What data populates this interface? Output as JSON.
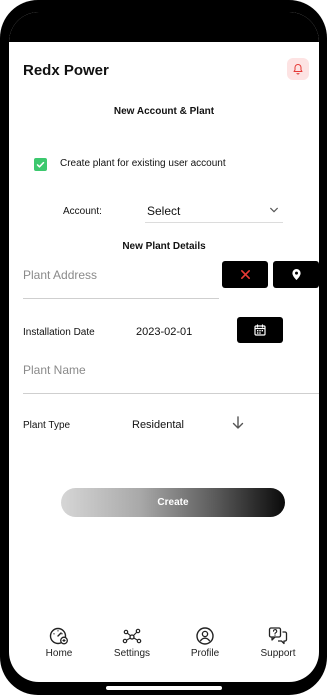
{
  "app": {
    "title": "Redx Power"
  },
  "page": {
    "title": "New Account & Plant"
  },
  "existing_account": {
    "label": "Create plant for existing user account",
    "checked": true
  },
  "account": {
    "label": "Account:",
    "value": "Select"
  },
  "plant_details": {
    "title": "New Plant Details",
    "address_placeholder": "Plant Address",
    "installation_date_label": "Installation Date",
    "installation_date_value": "2023-02-01",
    "name_placeholder": "Plant Name",
    "type_label": "Plant Type",
    "type_value": "Residental"
  },
  "create_button": {
    "label": "Create"
  },
  "tabs": [
    {
      "label": "Home",
      "icon": "home-gauge-icon"
    },
    {
      "label": "Settings",
      "icon": "settings-nodes-icon"
    },
    {
      "label": "Profile",
      "icon": "profile-icon"
    },
    {
      "label": "Support",
      "icon": "support-chat-icon"
    }
  ],
  "colors": {
    "accent_red": "#e53935",
    "checkbox_green": "#3cc86e",
    "button_black": "#000000",
    "bell_bg": "#fde3e3"
  }
}
